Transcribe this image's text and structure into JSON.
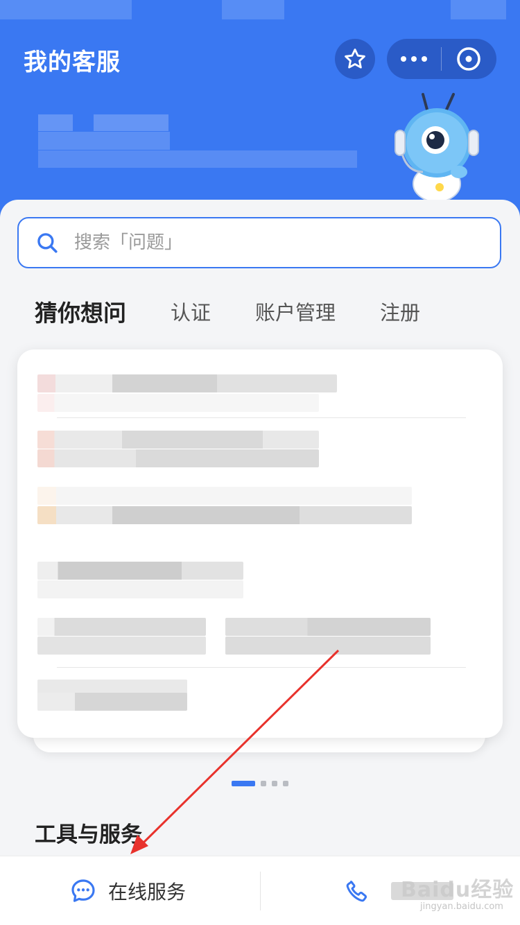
{
  "header": {
    "title": "我的客服",
    "star_icon": "star-icon",
    "more_icon": "more-dots-icon",
    "close_icon": "close-circle-icon"
  },
  "search": {
    "placeholder": "搜索「问题」",
    "icon": "search-icon"
  },
  "tabs": [
    {
      "label": "猜你想问",
      "active": true
    },
    {
      "label": "认证",
      "active": false
    },
    {
      "label": "账户管理",
      "active": false
    },
    {
      "label": "注册",
      "active": false
    }
  ],
  "carousel": {
    "pages": 4,
    "current": 1
  },
  "tools_section": {
    "title": "工具与服务"
  },
  "bottom_bar": {
    "online_service_label": "在线服务",
    "online_icon": "chat-bubble-icon",
    "phone_icon": "phone-icon"
  },
  "watermark": {
    "text": "Baidu经验",
    "sub": "jingyan.baidu.com"
  },
  "colors": {
    "primary": "#3a78f2",
    "annotation_arrow": "#e8322c"
  }
}
